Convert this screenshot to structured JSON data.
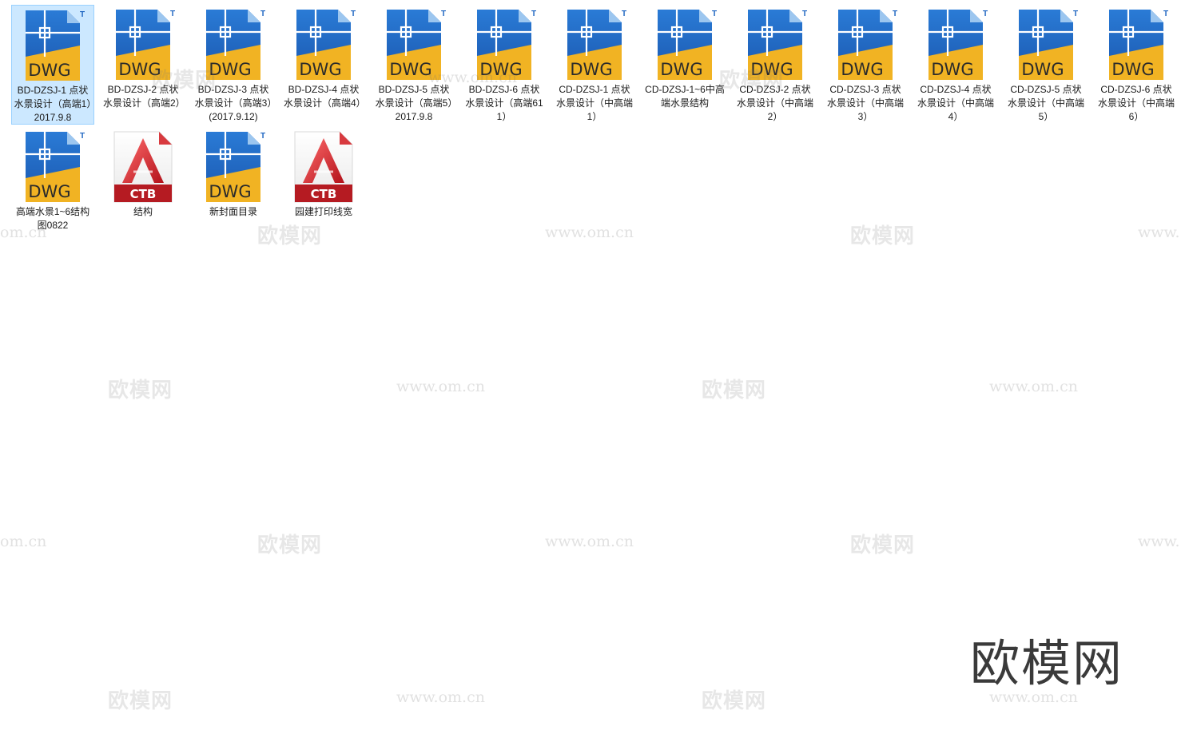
{
  "files": [
    {
      "name": "BD-DZSJ-1 点状水景设计（高端1）2017.9.8",
      "type": "DWG",
      "selected": true
    },
    {
      "name": "BD-DZSJ-2 点状水景设计（高端2）",
      "type": "DWG"
    },
    {
      "name": "BD-DZSJ-3 点状水景设计（高端3）(2017.9.12)",
      "type": "DWG"
    },
    {
      "name": "BD-DZSJ-4 点状水景设计（高端4）",
      "type": "DWG"
    },
    {
      "name": "BD-DZSJ-5 点状水景设计（高端5）2017.9.8",
      "type": "DWG"
    },
    {
      "name": "BD-DZSJ-6 点状水景设计（高端611）",
      "type": "DWG"
    },
    {
      "name": "CD-DZSJ-1 点状水景设计（中高端1）",
      "type": "DWG"
    },
    {
      "name": "CD-DZSJ-1~6中高端水景结构",
      "type": "DWG"
    },
    {
      "name": "CD-DZSJ-2 点状水景设计（中高端2）",
      "type": "DWG"
    },
    {
      "name": "CD-DZSJ-3 点状水景设计（中高端3）",
      "type": "DWG"
    },
    {
      "name": "CD-DZSJ-4 点状水景设计（中高端4）",
      "type": "DWG"
    },
    {
      "name": "CD-DZSJ-5 点状水景设计（中高端5）",
      "type": "DWG"
    },
    {
      "name": "CD-DZSJ-6 点状水景设计（中高端6）",
      "type": "DWG"
    },
    {
      "name": "高端水景1~6结构图0822",
      "type": "DWG"
    },
    {
      "name": "结构",
      "type": "CTB"
    },
    {
      "name": "新封面目录",
      "type": "DWG"
    },
    {
      "name": "园建打印线宽",
      "type": "CTB"
    }
  ],
  "icon_text": {
    "dwg": "DWG",
    "ctb": "CTB",
    "tm": "TM"
  },
  "watermark": {
    "cn": "欧模网",
    "url": "www.om.cn",
    "url_short": "om.cn",
    "url_prefix": "www."
  },
  "logo_text": "欧模网",
  "colors": {
    "dwg_blue": "#1d65c1",
    "dwg_yellow": "#f1b323",
    "ctb_red": "#c8232c",
    "selection_bg": "#cce8ff",
    "selection_border": "#99d1ff"
  }
}
